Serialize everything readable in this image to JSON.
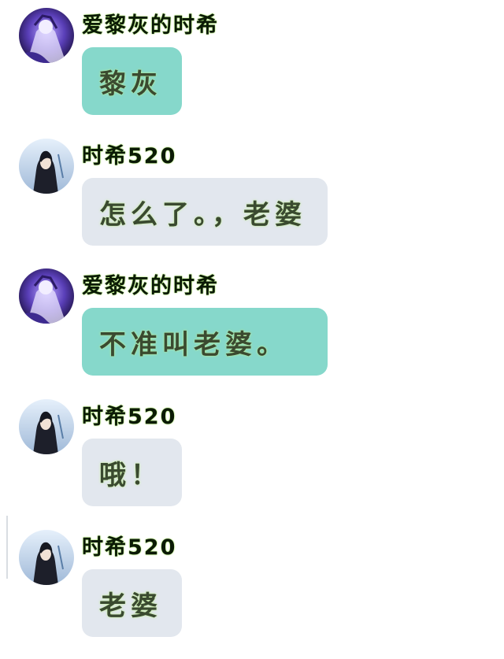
{
  "colors": {
    "self_bubble": "#86d8cb",
    "other_bubble": "#e2e7ee",
    "name_text": "#0b1a06",
    "message_text": "#3a4a30",
    "text_glow": "#b8f07a"
  },
  "messages": [
    {
      "sender": "爱黎灰的时希",
      "avatar": "purple-character-avatar",
      "bubble": "teal",
      "text": "黎灰"
    },
    {
      "sender": "时希520",
      "avatar": "dark-haired-character-avatar",
      "bubble": "gray",
      "text": "怎么了。，老婆"
    },
    {
      "sender": "爱黎灰的时希",
      "avatar": "purple-character-avatar",
      "bubble": "teal",
      "text": "不准叫老婆。"
    },
    {
      "sender": "时希520",
      "avatar": "dark-haired-character-avatar",
      "bubble": "gray",
      "text": "哦！"
    },
    {
      "sender": "时希520",
      "avatar": "dark-haired-character-avatar",
      "bubble": "gray",
      "text": "老婆"
    }
  ]
}
